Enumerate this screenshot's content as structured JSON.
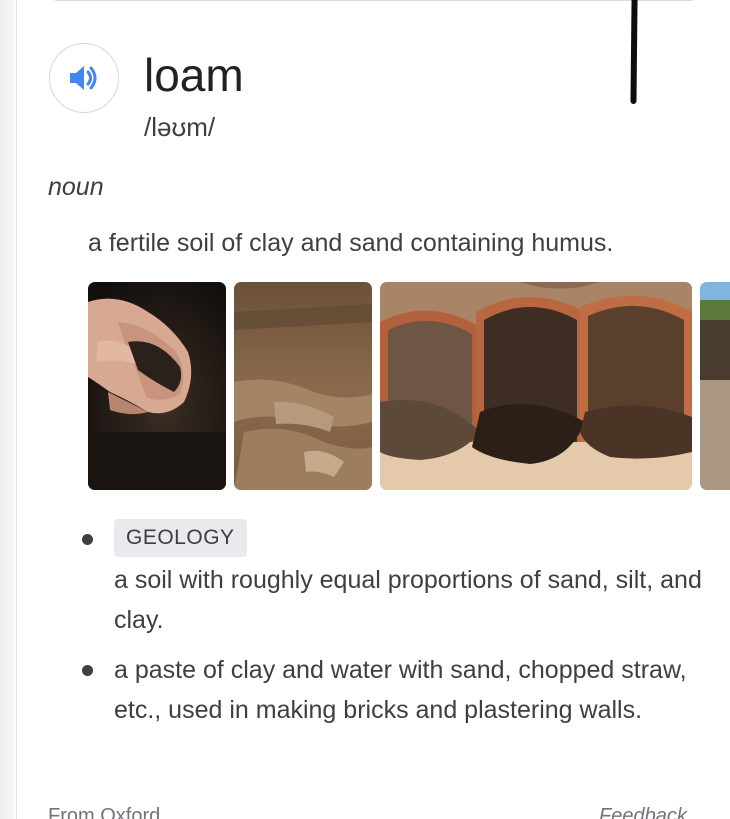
{
  "entry": {
    "word": "loam",
    "phonetic": "/ləʊm/",
    "part_of_speech": "noun",
    "primary_definition": "a fertile soil of clay and sand containing humus."
  },
  "images": [
    {
      "subject": "hands holding dark loam soil"
    },
    {
      "subject": "dry brown soil surface"
    },
    {
      "subject": "three terracotta pots spilling soil"
    },
    {
      "subject": "soil profile with grass on top"
    }
  ],
  "senses": [
    {
      "tag": "GEOLOGY",
      "text": "a soil with roughly equal proportions of sand, silt, and clay."
    },
    {
      "tag": "",
      "text": "a paste of clay and water with sand, chopped straw, etc., used in making bricks and plastering walls."
    }
  ],
  "footer": {
    "source": "From Oxford",
    "feedback": "Feedback"
  },
  "colors": {
    "speaker_icon": "#4285f4",
    "text_primary": "#202124",
    "text_secondary": "#3c4043",
    "tag_background": "#e8eaed"
  },
  "icons": {
    "speaker": "speaker-volume-icon"
  }
}
